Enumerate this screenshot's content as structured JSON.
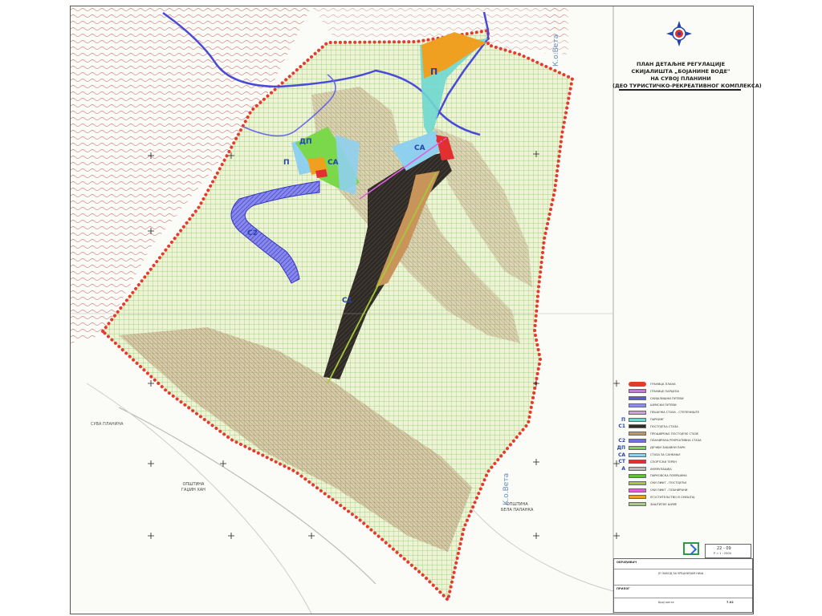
{
  "title": {
    "line1": "ПЛАН ДЕТАЉНЕ РЕГУЛАЦИЈЕ",
    "line2": "СКИЈАЛИШТА „БОЈАНИНЕ ВОДЕ\"",
    "line3": "НА СУВОЈ ПЛАНИНИ",
    "line4": "(ДЕО ТУРИСТИЧКО-РЕКРЕАТИВНОГ КОМПЛЕКСА)"
  },
  "map_labels": {
    "cadastre_veta_top": "К.о.Вета",
    "cadastre_veta_bottom": "К.о.Вета",
    "suva_planina": "СУВА ПЛАНИНА",
    "muni_gadzin_han_1": "ОПШТИНА",
    "muni_gadzin_han_2": "ГАЏИН ХАН",
    "muni_bela_palanka_1": "ОПШТИНА",
    "muni_bela_palanka_2": "БЕЛА ПАЛАНКА",
    "zone_p": "П",
    "zone_dp": "ДП",
    "zone_sa_left": "СА",
    "zone_p_left": "П",
    "zone_sa_right": "СА",
    "zone_st": "СТ",
    "zone_c1": "С1",
    "zone_c2": "С2"
  },
  "legend": [
    {
      "code": "",
      "label": "ГРАНИЦА ПЛАНА",
      "color": "#e53b2f"
    },
    {
      "code": "",
      "label": "ГРАНИЦЕ ПАРЦЕЛА",
      "color": "#c080d0"
    },
    {
      "code": "",
      "label": "СКИЈАЛИШНИ ПУТЕВИ",
      "color": "#5a5adc"
    },
    {
      "code": "",
      "label": "ШУМСКИ ПУТЕВИ",
      "color": "#8f8fe8"
    },
    {
      "code": "",
      "label": "ПЕШАЧКА СТАЗА - СТЕПЕНИШТЕ",
      "color": "#d0a0e0"
    },
    {
      "code": "П",
      "label": "ПАРКИНГ",
      "color": "#6fd8d0"
    },
    {
      "code": "С1",
      "label": "ПОСТОЈЕЋА СТАЗА",
      "color": "#2e2a26"
    },
    {
      "code": "",
      "label": "ПРОШИРЕЊЕ ПОСТОЈЕЋЕ СТАЗЕ",
      "color": "#c9945a"
    },
    {
      "code": "С2",
      "label": "ПЛАНИРАНА РЕКРЕАТИВНА СТАЗА",
      "color": "#7070e0"
    },
    {
      "code": "ДП",
      "label": "ДЕЧИЈИ ЗАБАВНИ ПАРК",
      "color": "#7ad84a"
    },
    {
      "code": "СА",
      "label": "СТАЗА ЗА САНКАЊЕ",
      "color": "#8fd0ee"
    },
    {
      "code": "СТ",
      "label": "СПОРТСКИ ТЕРЕН",
      "color": "#e23030"
    },
    {
      "code": "А",
      "label": "АКУМУЛАЦИЈА",
      "color": "#bbbbbb"
    },
    {
      "code": "",
      "label": "ПАРКОВСКА ПОВРШИНА",
      "color": "#5fbf3a"
    },
    {
      "code": "",
      "label": "СКИ ЛИФТ - ПОСТОЈЕЋИ",
      "color": "#a6c83a"
    },
    {
      "code": "",
      "label": "СКИ ЛИФТ - ПЛАНИРАНИ",
      "color": "#e060e0"
    },
    {
      "code": "",
      "label": "УГОСТИТЕЉСТВО И СМЕШТАЈ",
      "color": "#f0a020"
    },
    {
      "code": "",
      "label": "ЗАШТИТНЕ ШУМЕ",
      "color": "#9fd07a"
    }
  ],
  "stamp": {
    "header": "ОБРАЂИВАЧ",
    "sheet_number": "22 - 09",
    "sheet_label": "Р = 1 : 2500",
    "prilog": "ПРИЛОГ",
    "plan_no": "Број листа",
    "plan_no_value": "7.02",
    "company": "ЈП ЗАВОД ЗА УРБАНИЗАМ НИШ"
  },
  "colors": {
    "plan_border": "#e53b2f",
    "grid_green": "#9bd274",
    "base_fill": "#eef3d6",
    "contour": "#c85a5a",
    "river": "#4a4ad8"
  }
}
